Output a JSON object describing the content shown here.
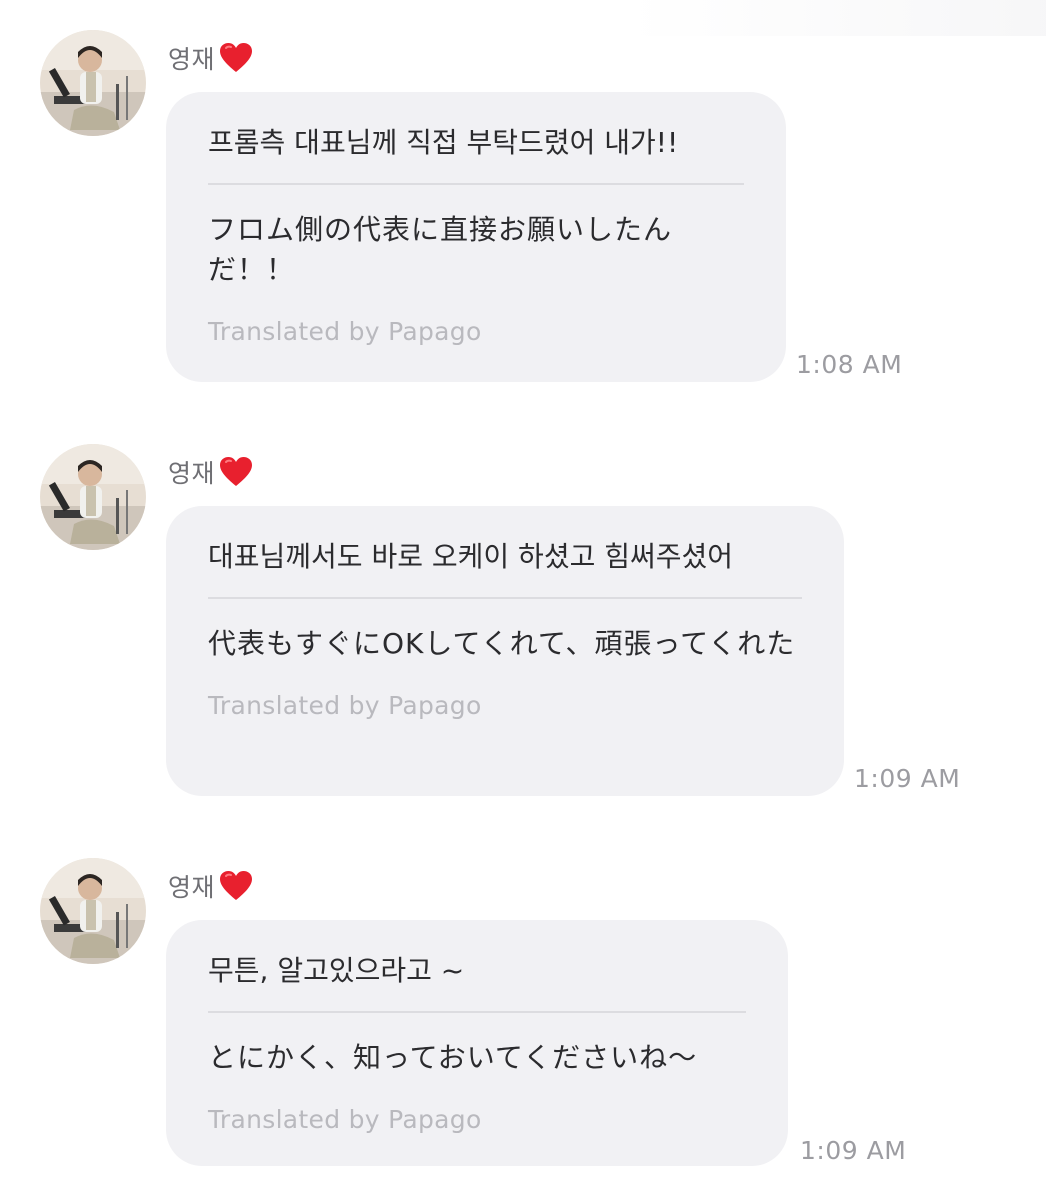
{
  "messages": [
    {
      "sender": "영재",
      "original": "프롬측 대표님께 직접 부탁드렸어 내가!!",
      "translated": "フロム側の代表に直接お願いしたんだ！！",
      "translated_by": "Translated by Papago",
      "time": "1:08 AM"
    },
    {
      "sender": "영재",
      "original": "대표님께서도 바로 오케이 하셨고 힘써주셨어",
      "translated": "代表もすぐにOKしてくれて、頑張ってくれた",
      "translated_by": "Translated by Papago",
      "time": "1:09 AM"
    },
    {
      "sender": "영재",
      "original": "무튼, 알고있으라고 ~",
      "translated": "とにかく、知っておいてくださいね〜",
      "translated_by": "Translated by Papago",
      "time": "1:09 AM"
    }
  ],
  "icons": {
    "heart": "red-heart-icon"
  },
  "colors": {
    "bubble": "#f1f1f4",
    "heart": "#e8202e",
    "sender_text": "#6f6f74",
    "muted_text": "#b9b9be",
    "time_text": "#9c9ca1"
  }
}
